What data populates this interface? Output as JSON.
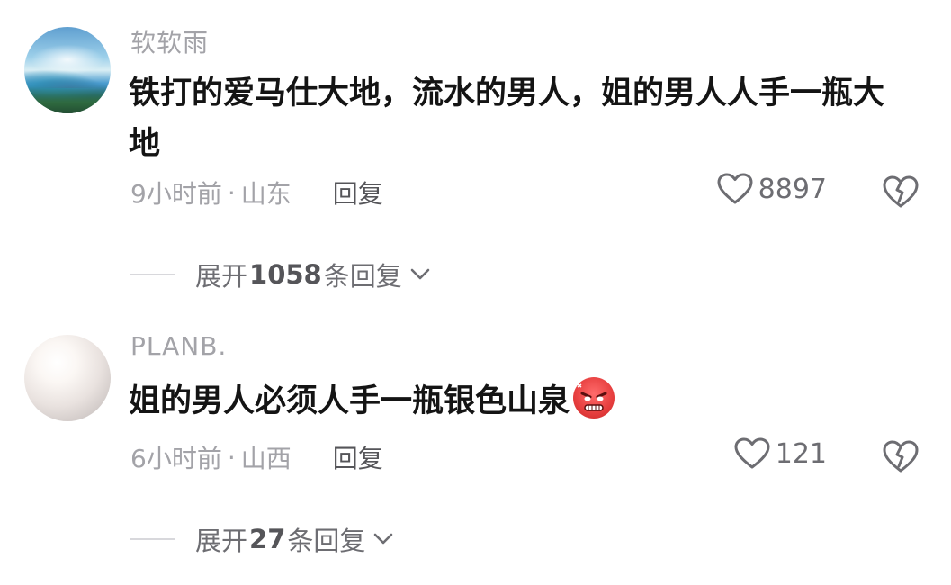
{
  "comments": [
    {
      "username": "软软雨",
      "text": "铁打的爱马仕大地，流水的男人，姐的男人人手一瓶大地",
      "time": "9小时前",
      "location": "山东",
      "reply_label": "回复",
      "likes": "8897",
      "expand_prefix": "展开",
      "expand_count": "1058",
      "expand_suffix": "条回复",
      "avatar_icon": "landscape-avatar"
    },
    {
      "username": "PLANB.",
      "text": "姐的男人必须人手一瓶银色山泉",
      "emoji": "angry-face-emoji",
      "time": "6小时前",
      "location": "山西",
      "reply_label": "回复",
      "likes": "121",
      "expand_prefix": "展开",
      "expand_count": "27",
      "expand_suffix": "条回复",
      "avatar_icon": "pearl-avatar"
    }
  ],
  "separator": "·",
  "colors": {
    "muted_text": "#a3a3a8",
    "body_text": "#141414",
    "icon_gray": "#6d6d72"
  }
}
